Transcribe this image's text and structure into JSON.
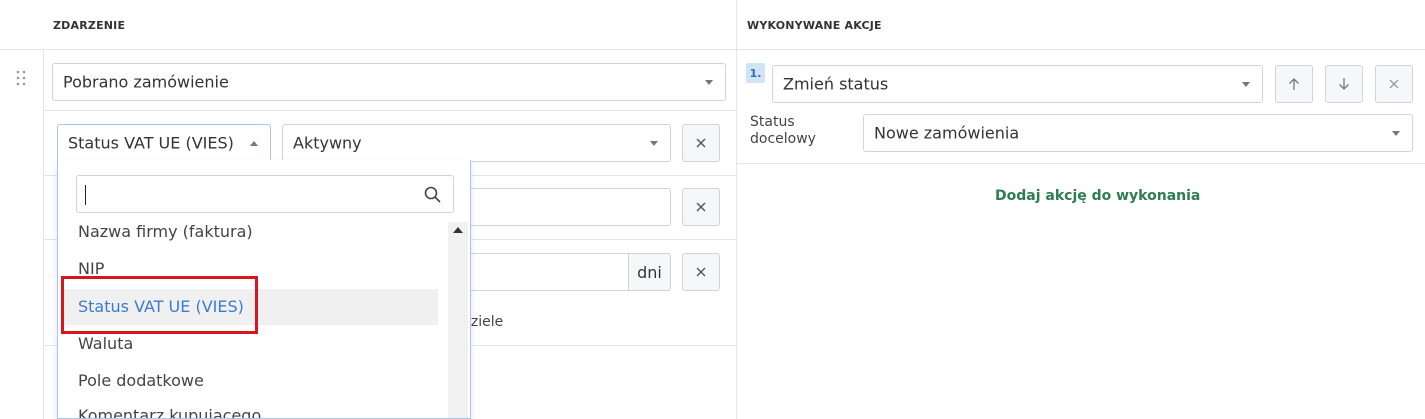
{
  "headers": {
    "event": "ZDARZENIE",
    "actions": "WYKONYWANE AKCJE"
  },
  "event": {
    "trigger_value": "Pobrano zamówienie"
  },
  "condition": {
    "field_value": "Status VAT UE (VIES)",
    "operator_value": "Aktywny",
    "days_unit": "dni",
    "weekdays_partial": "dziele"
  },
  "dropdown": {
    "search_placeholder": "",
    "options": [
      "Nazwa firmy (faktura)",
      "NIP",
      "Status VAT UE (VIES)",
      "Waluta",
      "Pole dodatkowe",
      "Komentarz kupującego"
    ],
    "selected_index": 2
  },
  "action": {
    "number": "1.",
    "type_value": "Zmień status",
    "target_label": "Status docelowy",
    "target_value": "Nowe zamówienia",
    "add_action_label": "Dodaj akcję do wykonania"
  },
  "colors": {
    "accent": "#3a7bd5",
    "highlight": "#d8161e",
    "add_action": "#2e7d4f",
    "badge_bg": "#cfe4f7"
  }
}
